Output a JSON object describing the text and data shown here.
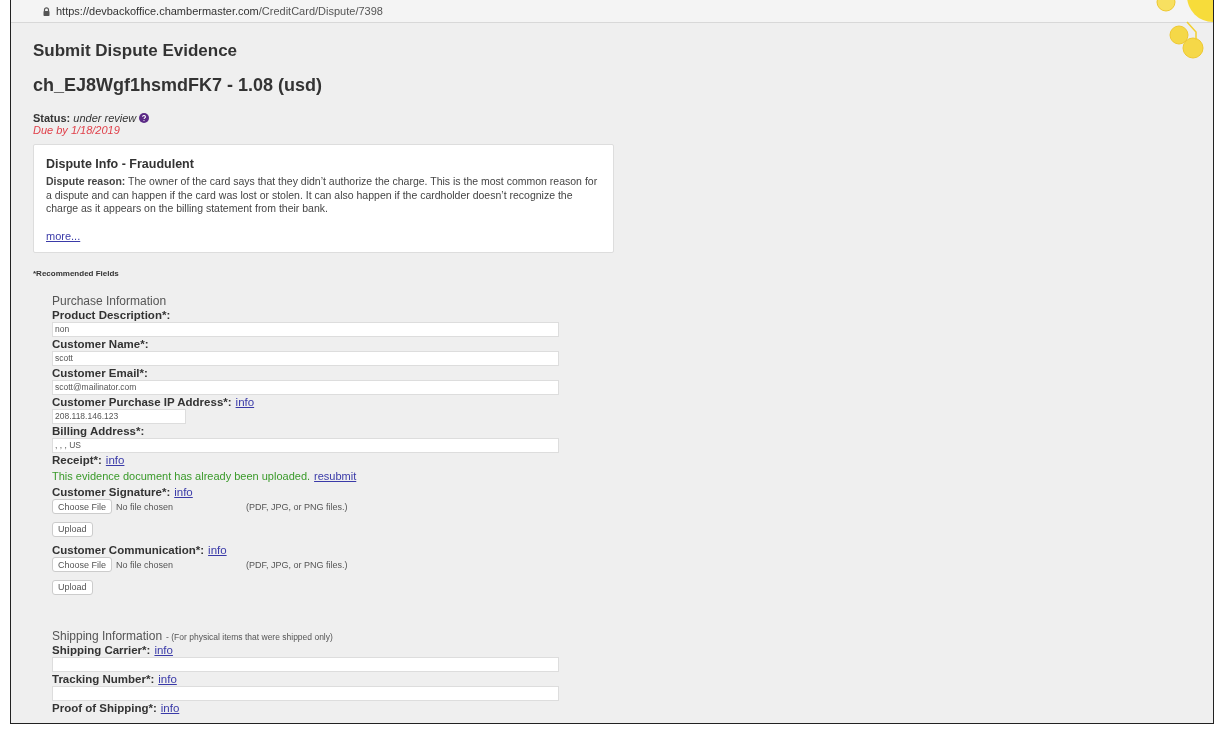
{
  "address_bar": {
    "url_host": "https://devbackoffice.chambermaster.com",
    "url_path": "/CreditCard/Dispute/7398"
  },
  "title": "Submit Dispute Evidence",
  "charge": "ch_EJ8Wgf1hsmdFK7 - 1.08 (usd)",
  "status": {
    "label": "Status:",
    "value": "under review",
    "due": "Due by 1/18/2019"
  },
  "dispute_info": {
    "title": "Dispute Info - Fraudulent",
    "text": "**Dispute reason:** The owner of the card says that they didn’t authorize the charge. This is the most common reason for a dispute and can happen if the card was lost or stolen. It can also happen if the cardholder doesn’t recognize the charge as it appears on the billing statement from their bank.",
    "link": "more..."
  },
  "recommended_note": "*Recommended Fields",
  "sections": [
    {
      "title": "Purchase Information",
      "fields": [
        {
          "kind": "text",
          "label": "Product Description*:",
          "value": "non",
          "wide": true
        },
        {
          "kind": "text",
          "label": "Customer Name*:",
          "value": "scott",
          "wide": true
        },
        {
          "kind": "text",
          "label": "Customer Email*:",
          "value": "scott@mailinator.com",
          "wide": true
        },
        {
          "kind": "text",
          "label": "Customer Purchase IP Address*:",
          "info": "info",
          "value": "208.118.146.123",
          "wide": false
        },
        {
          "kind": "text",
          "label": "Billing Address*:",
          "value": ", , , US",
          "wide": true
        },
        {
          "kind": "uploaded",
          "label": "Receipt*:",
          "info": "info",
          "message": "This evidence document has already been uploaded.",
          "link": "resubmit"
        },
        {
          "kind": "file",
          "label": "Customer Signature*:",
          "info": "info",
          "choose": "Choose File",
          "file_status": "No file chosen",
          "hint": "(PDF, JPG, or PNG files.)",
          "upload": "Upload"
        },
        {
          "kind": "file",
          "label": "Customer Communication*:",
          "info": "info",
          "choose": "Choose File",
          "file_status": "No file chosen",
          "hint": "(PDF, JPG, or PNG files.)",
          "upload": "Upload"
        }
      ]
    },
    {
      "title": "Shipping Information",
      "note": "- (For physical items that were shipped only)",
      "fields": [
        {
          "kind": "text",
          "label": "Shipping Carrier*:",
          "info": "info",
          "wide": true
        },
        {
          "kind": "text",
          "label": "Tracking Number*:",
          "info": "info",
          "wide": true
        },
        {
          "kind": "label",
          "label": "Proof of Shipping*:",
          "info": "info"
        }
      ]
    }
  ]
}
